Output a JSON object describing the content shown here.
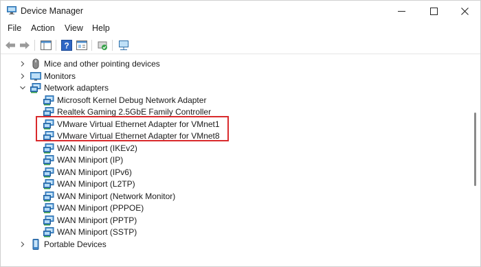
{
  "window": {
    "title": "Device Manager"
  },
  "menu": [
    "File",
    "Action",
    "View",
    "Help"
  ],
  "tree": {
    "categories": [
      {
        "label": "Mice and other pointing devices",
        "icon": "mouse-icon",
        "expanded": false
      },
      {
        "label": "Monitors",
        "icon": "monitor-icon",
        "expanded": false
      },
      {
        "label": "Network adapters",
        "icon": "network-adapter-icon",
        "expanded": true
      },
      {
        "label": "Portable Devices",
        "icon": "portable-device-icon",
        "expanded": false
      }
    ],
    "network_adapters": [
      "Microsoft Kernel Debug Network Adapter",
      "Realtek Gaming 2.5GbE Family Controller",
      "VMware Virtual Ethernet Adapter for VMnet1",
      "VMware Virtual Ethernet Adapter for VMnet8",
      "WAN Miniport (IKEv2)",
      "WAN Miniport (IP)",
      "WAN Miniport (IPv6)",
      "WAN Miniport (L2TP)",
      "WAN Miniport (Network Monitor)",
      "WAN Miniport (PPPOE)",
      "WAN Miniport (PPTP)",
      "WAN Miniport (SSTP)"
    ]
  },
  "colors": {
    "highlight_border": "#d9292b",
    "adapter_icon": "#3f86c9",
    "accent_green": "#37a24a"
  }
}
